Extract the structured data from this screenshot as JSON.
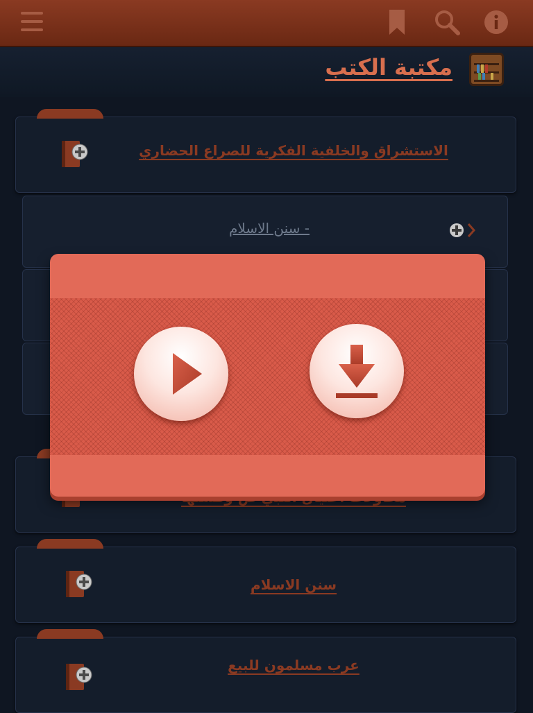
{
  "header": {
    "title": "مكتبة الكتب"
  },
  "toolbar": {
    "icons": [
      "menu-icon",
      "bookmark-icon",
      "search-icon",
      "info-icon"
    ]
  },
  "books": [
    {
      "title": "الاستشراق والخلفية الفكرية للصراع الحضاري"
    },
    {
      "title": "محاولات اغتيال النبي ص وفشلها"
    },
    {
      "title": "سنن الاسلام"
    },
    {
      "title": "عرب مسلمون للبيع"
    }
  ],
  "subitems": [
    {
      "title": "- سنن الاسلام"
    }
  ],
  "overlay": {
    "actions": [
      "play-icon",
      "download-icon"
    ]
  },
  "colors": {
    "topbar": "#7a3119",
    "accent": "#d86f4e",
    "overlay": "#e26a58",
    "background": "#0f1622"
  }
}
